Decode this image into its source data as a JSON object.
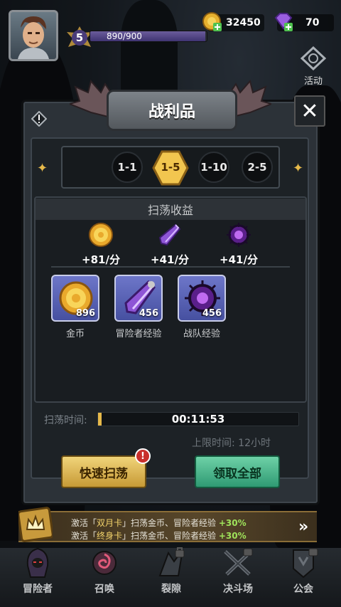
{
  "hud": {
    "level": "5",
    "xp_text": "890/900",
    "xp_fraction": 0.989,
    "gold": "32450",
    "gems": "70",
    "side_button_label": "活动"
  },
  "dialog": {
    "title": "战利品",
    "stages": [
      {
        "label": "1-1",
        "active": false
      },
      {
        "label": "1-5",
        "active": true
      },
      {
        "label": "1-10",
        "active": false
      },
      {
        "label": "2-5",
        "active": false
      }
    ],
    "income_header": "扫荡收益",
    "rates": [
      {
        "icon": "gold-coin-icon",
        "text": "+81/分"
      },
      {
        "icon": "adventurer-exp-crystal-icon",
        "text": "+41/分"
      },
      {
        "icon": "team-exp-orb-icon",
        "text": "+41/分"
      }
    ],
    "items": [
      {
        "icon": "gold-coin-icon",
        "count": "896",
        "name": "金币"
      },
      {
        "icon": "adventurer-exp-crystal-icon",
        "count": "456",
        "name": "冒险者经验"
      },
      {
        "icon": "team-exp-orb-icon",
        "count": "456",
        "name": "战队经验"
      }
    ],
    "sweep_label": "扫荡时间:",
    "sweep_time": "00:11:53",
    "sweep_fraction": 0.016,
    "limit_text": "上限时间: 12小时",
    "quick_sweep_label": "快速扫荡",
    "claim_all_label": "领取全部",
    "badge_text": "!"
  },
  "promo": {
    "line1_prefix": "激活「",
    "line1_card": "双月卡",
    "line1_mid": "」扫荡金币、冒险者经验 ",
    "line1_pct": "+30%",
    "line2_prefix": "激活「",
    "line2_card": "终身卡",
    "line2_mid": "」扫荡金币、冒险者经验 ",
    "line2_pct": "+30%"
  },
  "nav": [
    {
      "label": "冒险者",
      "icon": "adventurer-icon",
      "locked": false
    },
    {
      "label": "召唤",
      "icon": "summon-icon",
      "locked": false
    },
    {
      "label": "裂隙",
      "icon": "rift-icon",
      "locked": true
    },
    {
      "label": "决斗场",
      "icon": "arena-icon",
      "locked": true
    },
    {
      "label": "公会",
      "icon": "guild-icon",
      "locked": true
    }
  ],
  "colors": {
    "accent_gold": "#e6b94a",
    "claim_green": "#2f9a73",
    "promo_pct": "#9fe35b"
  }
}
